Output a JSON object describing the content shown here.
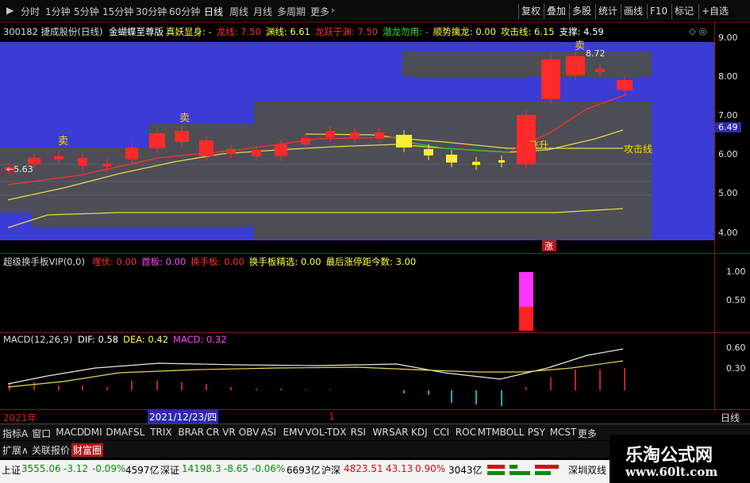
{
  "periods": [
    "分时",
    "1分钟",
    "5分钟",
    "15分钟",
    "30分钟",
    "60分钟",
    "日线",
    "周线",
    "月线",
    "多周期",
    "更多"
  ],
  "active_period": "日线",
  "more_arrow": "›",
  "right_buttons": [
    "复权",
    "叠加",
    "多股",
    "统计",
    "画线",
    "F10",
    "标记",
    "+自选"
  ],
  "title": {
    "stock": "300182 捷成股份(日线)",
    "indicator": "金蝴蝶至尊版",
    "items": [
      {
        "label": "真妖显身: -",
        "color": "#ffff40"
      },
      {
        "label": "龙线: 7.50",
        "color": "#ff3030"
      },
      {
        "label": "渊线: 6.61",
        "color": "#ffff40"
      },
      {
        "label": "龙跃于渊: 7.50",
        "color": "#ff3030"
      },
      {
        "label": "潜龙勿用: -",
        "color": "#33dd33"
      },
      {
        "label": "顺势擒龙: 0.00",
        "color": "#ffff40"
      },
      {
        "label": "攻击线: 6.15",
        "color": "#ffff40"
      },
      {
        "label": "支撑: 4.59",
        "color": "#ffffff"
      }
    ],
    "controls": "◇ ◎"
  },
  "main_chart": {
    "y_ticks": [
      "9.00",
      "8.00",
      "7.00",
      "6.00",
      "5.00",
      "4.00"
    ],
    "price_tag": "6.49",
    "annotations": {
      "sell1": "卖",
      "sell2": "卖",
      "sell3": "卖",
      "rise": "飞升",
      "attack": "攻击线",
      "low": "←5.63",
      "high": "8.72",
      "up_mark": "涨"
    }
  },
  "sub1": {
    "title": "超级换手板VIP(0,0)",
    "items": [
      {
        "label": "埋伏: 0.00",
        "color": "#ff3030"
      },
      {
        "label": "首板: 0.00",
        "color": "#ff44ff"
      },
      {
        "label": "换手板: 0.00",
        "color": "#ff3030"
      },
      {
        "label": "换手板精选: 0.00",
        "color": "#ffff40"
      },
      {
        "label": "最后涨停距今数: 3.00",
        "color": "#ffff40"
      }
    ],
    "y_ticks": [
      "1.00",
      "0.50"
    ]
  },
  "macd": {
    "title": "MACD(12,26,9)",
    "items": [
      {
        "label": "DIF: 0.58",
        "color": "#ffffff"
      },
      {
        "label": "DEA: 0.42",
        "color": "#ffff40"
      },
      {
        "label": "MACD: 0.32",
        "color": "#ff44ff"
      }
    ],
    "y_ticks": [
      "0.60",
      "0.30"
    ]
  },
  "time_axis": {
    "year": "2021年",
    "cursor_date": "2021/12/23/四",
    "mark": "1",
    "period_label": "日线"
  },
  "indicator_tabs": [
    "指标A",
    "窗口",
    "MACD",
    "DMI",
    "DMA",
    "FSL",
    "TRIX",
    "BRAR",
    "CR",
    "VR",
    "OBV",
    "ASI",
    "EMV",
    "VOL-TDX",
    "RSI",
    "WR",
    "SAR",
    "KDJ",
    "CCI",
    "ROC",
    "MTM",
    "BOLL",
    "PSY",
    "MCST",
    "更多"
  ],
  "tabs2": [
    "扩展∧",
    "关联报价",
    "财富圈"
  ],
  "status": {
    "sh_label": "上证",
    "sh_value": "3555.06",
    "sh_change": "-3.12",
    "sh_pct": "-0.09%",
    "sh_vol": "4597亿",
    "sz_label": "深证",
    "sz_value": "14198.3",
    "sz_change": "-8.65",
    "sz_pct": "-0.06%",
    "sz_vol": "6693亿",
    "hs_label": "沪深",
    "hs_value": "4823.51",
    "hs_change": "43.13",
    "hs_pct": "0.90%",
    "hs_vol": "3043亿",
    "right": "深圳双线"
  },
  "watermark": {
    "name": "乐淘公式网",
    "url": "www.60lt.com"
  }
}
